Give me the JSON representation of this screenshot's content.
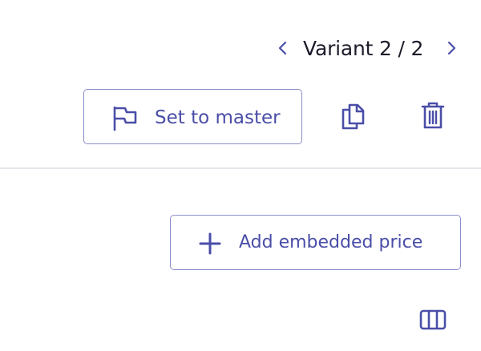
{
  "variant_pager": {
    "label": "Variant 2 / 2",
    "prev_icon": "chevron-left-icon",
    "next_icon": "chevron-right-icon"
  },
  "actions": {
    "set_master_label": "Set to master",
    "set_master_icon": "flag-icon",
    "copy_icon": "copy-icon",
    "delete_icon": "trash-icon"
  },
  "pricing": {
    "add_price_label": "Add embedded price",
    "add_price_icon": "plus-icon",
    "columns_icon": "columns-icon"
  },
  "colors": {
    "accent": "#4a4ea8",
    "button_border": "#8a8cc9",
    "text": "#1c1c2b",
    "divider": "#e6e7ec",
    "background": "#ffffff"
  }
}
